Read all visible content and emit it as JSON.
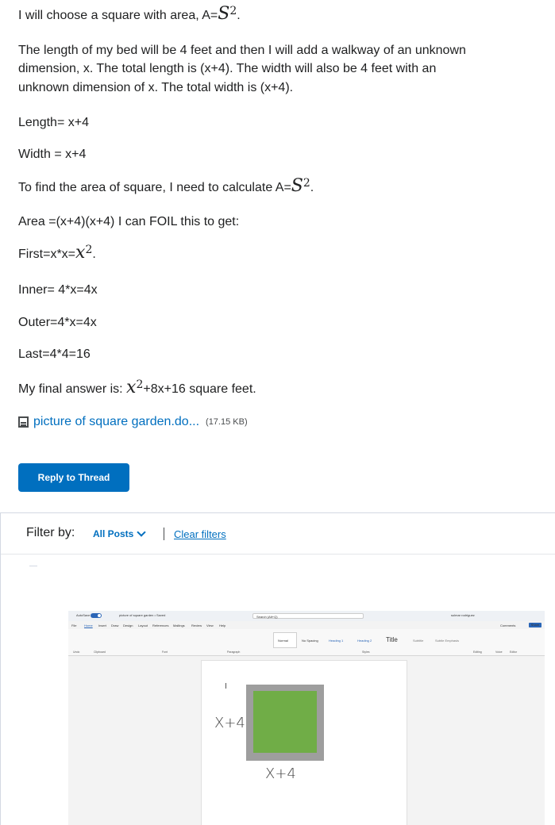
{
  "post": {
    "line1_prefix": "I will choose a square with area, A=",
    "line1_math_base": "S",
    "line1_math_exp": "2",
    "line1_suffix": ".",
    "para1_line1": "The length of my bed will be 4 feet and then I will add a walkway of an unknown",
    "para1_line2": "dimension, x. The total length is (x+4). The width will also be 4 feet with an",
    "para1_line3": "unknown dimension of x. The total width is (x+4).",
    "length_line": "Length= x+4",
    "width_line": "Width = x+4",
    "find_prefix": "To find the area of square, I need to calculate A=",
    "find_math_base": "S",
    "find_math_exp": "2",
    "find_suffix": ".",
    "area_line": "Area =(x+4)(x+4) I can FOIL this to get:",
    "first_prefix": "First=x*x=",
    "first_math_base": "x",
    "first_math_exp": "2",
    "first_suffix": ".",
    "inner_line": "Inner= 4*x=4x",
    "outer_line": "Outer=4*x=4x",
    "last_line": "Last=4*4=16",
    "final_prefix": "My final answer is: ",
    "final_math_base": "x",
    "final_math_exp": "2",
    "final_suffix": "+8x+16 square feet."
  },
  "attachment": {
    "icon": "document-icon",
    "name": "picture of square garden.do...",
    "size": "(17.15 KB)"
  },
  "reply_button": "Reply to Thread",
  "filter": {
    "label": "Filter by:",
    "selected": "All Posts",
    "clear": "Clear filters"
  },
  "word_screenshot": {
    "autosave": "AutoSave",
    "doc_title": "picture of square garden • Saved",
    "search": "Search (Alt+Q)",
    "user": "sulmar rodriguez",
    "tabs": [
      "File",
      "Home",
      "Insert",
      "Draw",
      "Design",
      "Layout",
      "References",
      "Mailings",
      "Review",
      "View",
      "Help"
    ],
    "comments": "Comments",
    "share": "Share",
    "styles": [
      "Normal",
      "No Spacing",
      "Heading 1",
      "Heading 2",
      "Title",
      "Subtitle",
      "Subtle Emphasis"
    ],
    "group_labels": [
      "Undo",
      "Clipboard",
      "Font",
      "Paragraph",
      "Styles",
      "Editing",
      "Voice",
      "Editor"
    ],
    "handwritten_side": "X+4",
    "handwritten_bottom": "X+4",
    "garden_color": "#70ad47",
    "walkway_color": "#9e9e9e"
  },
  "colors": {
    "link": "#006fbf",
    "button": "#006fbf",
    "text": "#202122"
  }
}
